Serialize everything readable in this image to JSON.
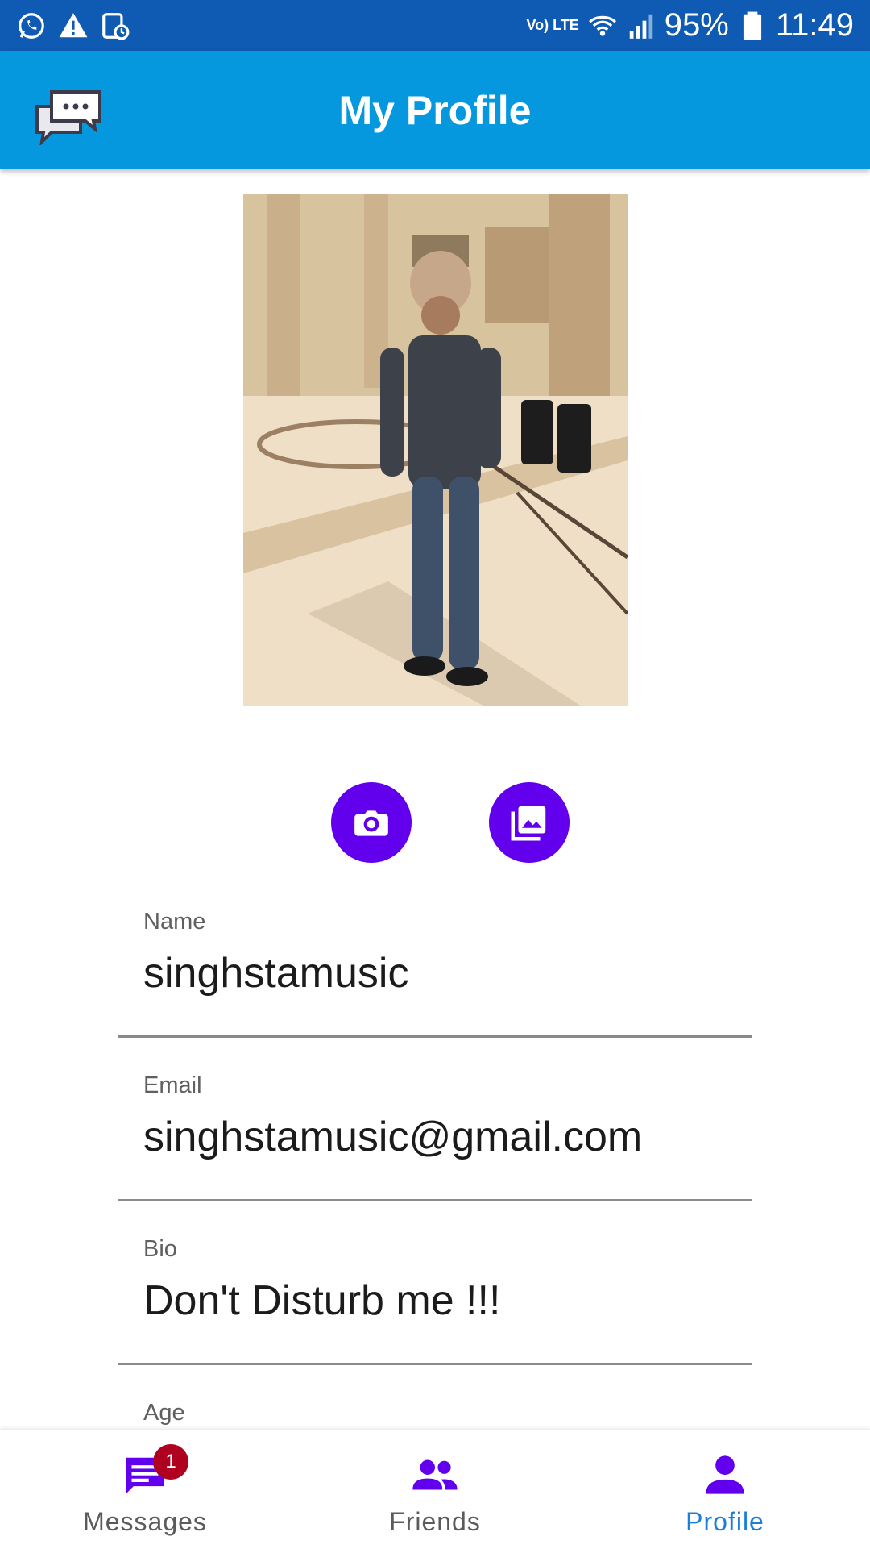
{
  "status_bar": {
    "network_label": "Vo) LTE",
    "battery_percent": "95%",
    "time": "11:49",
    "left_icons": [
      "whatsapp-icon",
      "warning-icon",
      "screenshot-icon"
    ]
  },
  "app_bar": {
    "title": "My Profile",
    "logo_icon": "chat-bubbles-icon",
    "color": "#0598df"
  },
  "photo_buttons": {
    "camera_icon": "camera-icon",
    "gallery_icon": "gallery-icon",
    "color": "#6200ee"
  },
  "fields": [
    {
      "label": "Name",
      "value": "singhstamusic"
    },
    {
      "label": "Email",
      "value": "singhstamusic@gmail.com"
    },
    {
      "label": "Bio",
      "value": "Don't Disturb me !!!"
    },
    {
      "label": "Age",
      "value": ""
    }
  ],
  "bottom_nav": {
    "items": [
      {
        "label": "Messages",
        "icon": "message-icon",
        "badge": "1",
        "active": false
      },
      {
        "label": "Friends",
        "icon": "friends-icon",
        "active": false
      },
      {
        "label": "Profile",
        "icon": "person-icon",
        "active": true
      }
    ],
    "accent_color": "#6200ee",
    "active_label_color": "#1b7fd8"
  }
}
